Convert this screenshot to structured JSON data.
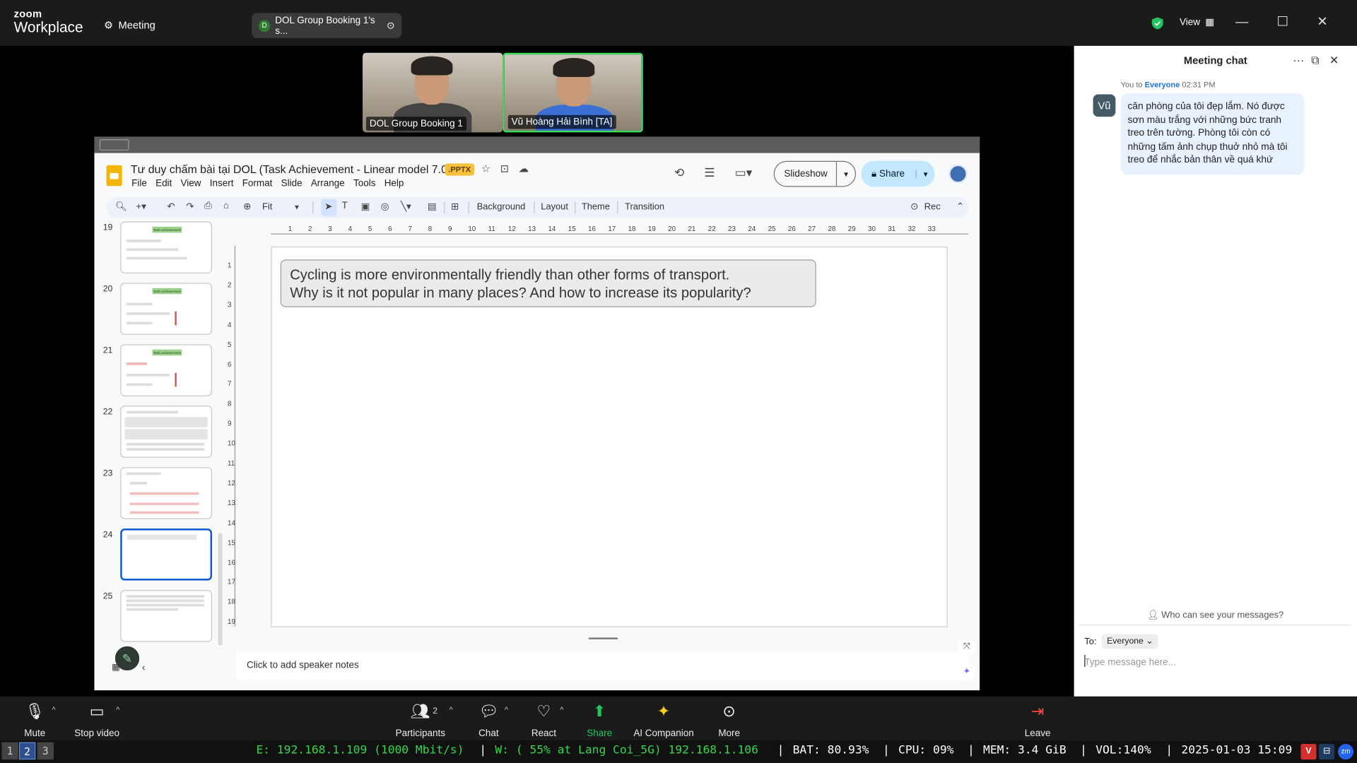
{
  "app": {
    "brand_top": "zoom",
    "brand_bottom": "Workplace",
    "meeting_label": "Meeting",
    "share_pill": "DOL Group Booking 1's s...",
    "share_pill_initial": "D",
    "view_label": "View"
  },
  "videos": [
    {
      "name": "DOL Group Booking 1",
      "active": false
    },
    {
      "name": "Vũ Hoàng Hải Bình [TA]",
      "active": true
    }
  ],
  "doc": {
    "title": "Tư duy chấm bài tại DOL (Task Achievement - Linear model 7.0)",
    "badge": ".PPTX",
    "menus": [
      "File",
      "Edit",
      "View",
      "Insert",
      "Format",
      "Slide",
      "Arrange",
      "Tools",
      "Help"
    ],
    "slideshow_label": "Slideshow",
    "share_label": "Share",
    "toolbar": {
      "zoom": "Fit",
      "background": "Background",
      "layout": "Layout",
      "theme": "Theme",
      "transition": "Transition",
      "rec": "Rec"
    },
    "ruler_h": [
      "1",
      "2",
      "3",
      "4",
      "5",
      "6",
      "7",
      "8",
      "9",
      "10",
      "11",
      "12",
      "13",
      "14",
      "15",
      "16",
      "17",
      "18",
      "19",
      "20",
      "21",
      "22",
      "23",
      "24",
      "25",
      "26",
      "27",
      "28",
      "29",
      "30",
      "31",
      "32",
      "33"
    ],
    "ruler_v": [
      "1",
      "2",
      "3",
      "4",
      "5",
      "6",
      "7",
      "8",
      "9",
      "10",
      "11",
      "12",
      "13",
      "14",
      "15",
      "16",
      "17",
      "18",
      "19"
    ],
    "slides": [
      {
        "num": "19",
        "kind": "ta",
        "thumb_label": "Task achievement"
      },
      {
        "num": "20",
        "kind": "ta-red",
        "thumb_label": "Task achievement"
      },
      {
        "num": "21",
        "kind": "ta-red",
        "thumb_label": "Task achievement"
      },
      {
        "num": "22",
        "kind": "boxes"
      },
      {
        "num": "23",
        "kind": "diagram"
      },
      {
        "num": "24",
        "kind": "current"
      },
      {
        "num": "25",
        "kind": "text"
      }
    ],
    "question_line1": "Cycling is more environmentally friendly than other forms of transport.",
    "question_line2": "Why is it not popular in many places? And how to increase its popularity?",
    "speaker_notes": "Click to add speaker notes"
  },
  "chat": {
    "title": "Meeting chat",
    "meta_from": "You to",
    "meta_to": "Everyone",
    "meta_time": "02:31 PM",
    "avatar": "Vũ",
    "message": "căn phòng của tôi đẹp lắm. Nó được sơn màu trắng với những bức tranh treo trên tường. Phòng tôi còn có những tấm ảnh chụp thuở nhỏ mà tôi treo để nhắc bản thân về quá khứ",
    "who_can_see": "Who can see your messages?",
    "to_label": "To:",
    "to_value": "Everyone",
    "placeholder": "Type message here..."
  },
  "bottom_bar": {
    "mute": "Mute",
    "stop_video": "Stop video",
    "participants": "Participants",
    "participants_count": "2",
    "chat": "Chat",
    "react": "React",
    "share": "Share",
    "ai": "AI Companion",
    "more": "More",
    "leave": "Leave"
  },
  "status_bar": {
    "workspaces": [
      "1",
      "2",
      "3"
    ],
    "active_workspace": "2",
    "eth": "E: 192.168.1.109 (1000 Mbit/s)",
    "wifi": "W: ( 55% at Lang Coi_5G) 192.168.1.106",
    "bat": "BAT: 80.93%",
    "cpu": "CPU: 09%",
    "mem": "MEM: 3.4 GiB",
    "vol": "VOL:140%",
    "datetime": "2025-01-03 15:09",
    "sep": "|"
  },
  "colors": {
    "accent_green": "#22c55e",
    "chat_bubble": "#e8f1fe",
    "selected_slide": "#0b57d0"
  }
}
